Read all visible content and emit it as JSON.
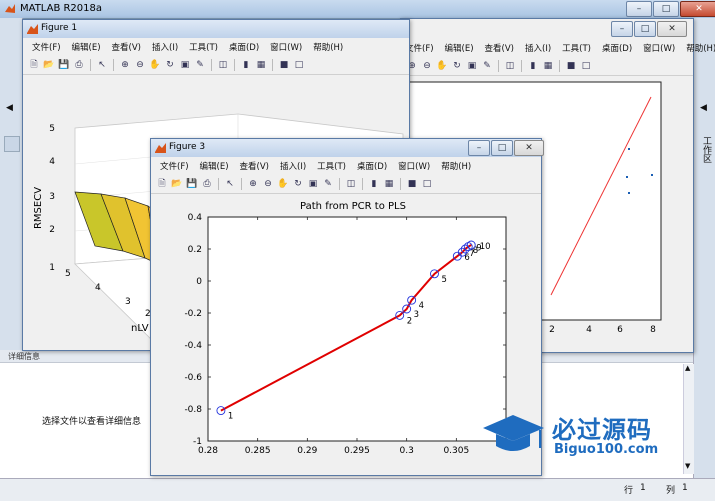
{
  "main": {
    "title": "MATLAB R2018a",
    "detail_label": "详细信息",
    "detail_hint": "选择文件以查看详细信息",
    "right_tab": "工作区",
    "status_row_label": "行",
    "status_row": "1",
    "status_col_label": "列",
    "status_col": "1"
  },
  "menu": [
    "文件(F)",
    "编辑(E)",
    "查看(V)",
    "插入(I)",
    "工具(T)",
    "桌面(D)",
    "窗口(W)",
    "帮助(H)"
  ],
  "figures": {
    "fig1": {
      "title": "Figure 1",
      "zlabel": "RMSECV",
      "ylabel": "nLV",
      "zticks": [
        "5",
        "4",
        "3",
        "2",
        "1"
      ],
      "yticks": [
        "5",
        "4",
        "3",
        "2"
      ]
    },
    "fig2": {
      "xticks": [
        "2",
        "4",
        "6",
        "8"
      ]
    },
    "fig3": {
      "title": "Figure 3"
    }
  },
  "watermark": {
    "text": "必过源码",
    "url": "Biguo100.com"
  },
  "chart_data": {
    "type": "line",
    "title": "Path from PCR to PLS",
    "xlabel": "",
    "ylabel": "",
    "xlim": [
      0.28,
      0.31
    ],
    "ylim": [
      -1,
      0.4
    ],
    "xticks": [
      0.28,
      0.285,
      0.29,
      0.295,
      0.3,
      0.305
    ],
    "yticks": [
      -1,
      -0.8,
      -0.6,
      -0.4,
      -0.2,
      0,
      0.2,
      0.4
    ],
    "grid": false,
    "series": [
      {
        "color": "#e00000",
        "marker": "circle",
        "marker_color": "#2233dd",
        "points": [
          {
            "x": 0.2813,
            "y": -0.81,
            "label": "1"
          },
          {
            "x": 0.2993,
            "y": -0.215,
            "label": "2"
          },
          {
            "x": 0.3,
            "y": -0.175,
            "label": "3"
          },
          {
            "x": 0.3005,
            "y": -0.12,
            "label": "4"
          },
          {
            "x": 0.3028,
            "y": 0.045,
            "label": "5"
          },
          {
            "x": 0.3051,
            "y": 0.155,
            "label": "6"
          },
          {
            "x": 0.3056,
            "y": 0.18,
            "label": "7"
          },
          {
            "x": 0.3059,
            "y": 0.2,
            "label": "8"
          },
          {
            "x": 0.3062,
            "y": 0.215,
            "label": "9"
          },
          {
            "x": 0.3065,
            "y": 0.225,
            "label": "10"
          }
        ]
      }
    ]
  }
}
